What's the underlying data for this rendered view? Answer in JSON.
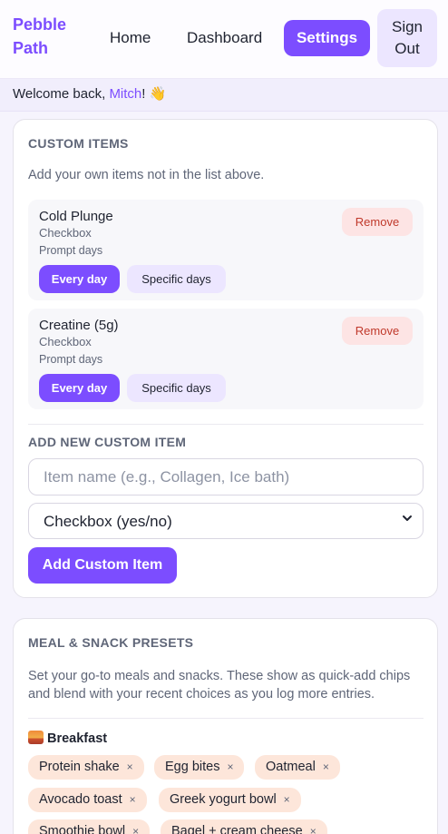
{
  "brand": {
    "name": "Pebble Path"
  },
  "nav": {
    "home": "Home",
    "dashboard": "Dashboard",
    "settings": "Settings",
    "sign_out": "Sign Out"
  },
  "welcome": {
    "prefix": "Welcome back, ",
    "user": "Mitch",
    "suffix": "! 👋"
  },
  "custom_items": {
    "title": "CUSTOM ITEMS",
    "description": "Add your own items not in the list above.",
    "items": [
      {
        "name": "Cold Plunge",
        "type": "Checkbox",
        "prompt_label": "Prompt days",
        "remove_label": "Remove",
        "option_every": "Every day",
        "option_specific": "Specific days",
        "selected": "Every day"
      },
      {
        "name": "Creatine (5g)",
        "type": "Checkbox",
        "prompt_label": "Prompt days",
        "remove_label": "Remove",
        "option_every": "Every day",
        "option_specific": "Specific days",
        "selected": "Every day"
      }
    ],
    "add_title": "ADD NEW CUSTOM ITEM",
    "name_placeholder": "Item name (e.g., Collagen, Ice bath)",
    "type_selected": "Checkbox (yes/no)",
    "add_button": "Add Custom Item"
  },
  "presets": {
    "title": "MEAL & SNACK PRESETS",
    "description": "Set your go-to meals and snacks. These show as quick-add chips and blend with your recent choices as you log more entries.",
    "breakfast_label": "Breakfast",
    "breakfast_chips": [
      "Protein shake",
      "Egg bites",
      "Oatmeal",
      "Avocado toast",
      "Greek yogurt bowl",
      "Smoothie bowl",
      "Bagel + cream cheese"
    ],
    "remove_glyph": "×"
  },
  "colors": {
    "accent": "#7c4dff",
    "accent_soft": "#ece6ff",
    "danger_bg": "#fde4e4",
    "danger_text": "#c0392b",
    "chip_bg": "#fde6da"
  }
}
